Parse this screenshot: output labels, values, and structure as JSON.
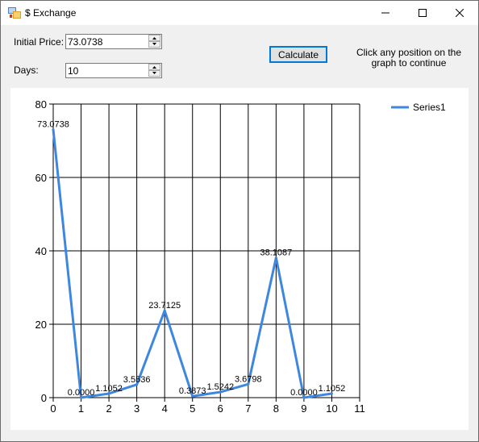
{
  "window": {
    "title": "$ Exchange",
    "minimize_glyph": "—",
    "maximize_glyph": "☐",
    "close_glyph": "✕"
  },
  "form": {
    "initial_price_label": "Initial Price:",
    "initial_price_value": "73.0738",
    "days_label": "Days:",
    "days_value": "10",
    "calculate_label": "Calculate",
    "hint": "Click any position on the graph to continue"
  },
  "icons": {
    "app": "app-icon",
    "spin_up": "chevron-up-icon",
    "spin_down": "chevron-down-icon"
  },
  "chart_data": {
    "type": "line",
    "x": [
      0,
      1,
      2,
      3,
      4,
      5,
      6,
      7,
      8,
      9,
      10
    ],
    "series": [
      {
        "name": "Series1",
        "color": "#3d87e0",
        "values": [
          73.0738,
          0.0,
          1.1052,
          3.5536,
          23.7125,
          0.3873,
          1.5242,
          3.6798,
          38.1087,
          0.0,
          1.1052
        ],
        "labels": [
          "73.0738",
          "0.0000",
          "1.1052",
          "3.5536",
          "23.7125",
          "0.3873",
          "1.5242",
          "3.6798",
          "38.1087",
          "0.0000",
          "1.1052"
        ]
      }
    ],
    "xlim": [
      0,
      11
    ],
    "ylim": [
      0,
      80
    ],
    "x_ticks": [
      "0",
      "1",
      "2",
      "3",
      "4",
      "5",
      "6",
      "7",
      "8",
      "9",
      "10",
      "11"
    ],
    "y_ticks": [
      "0",
      "20",
      "40",
      "60",
      "80"
    ],
    "grid": true,
    "legend_position": "top-right"
  }
}
